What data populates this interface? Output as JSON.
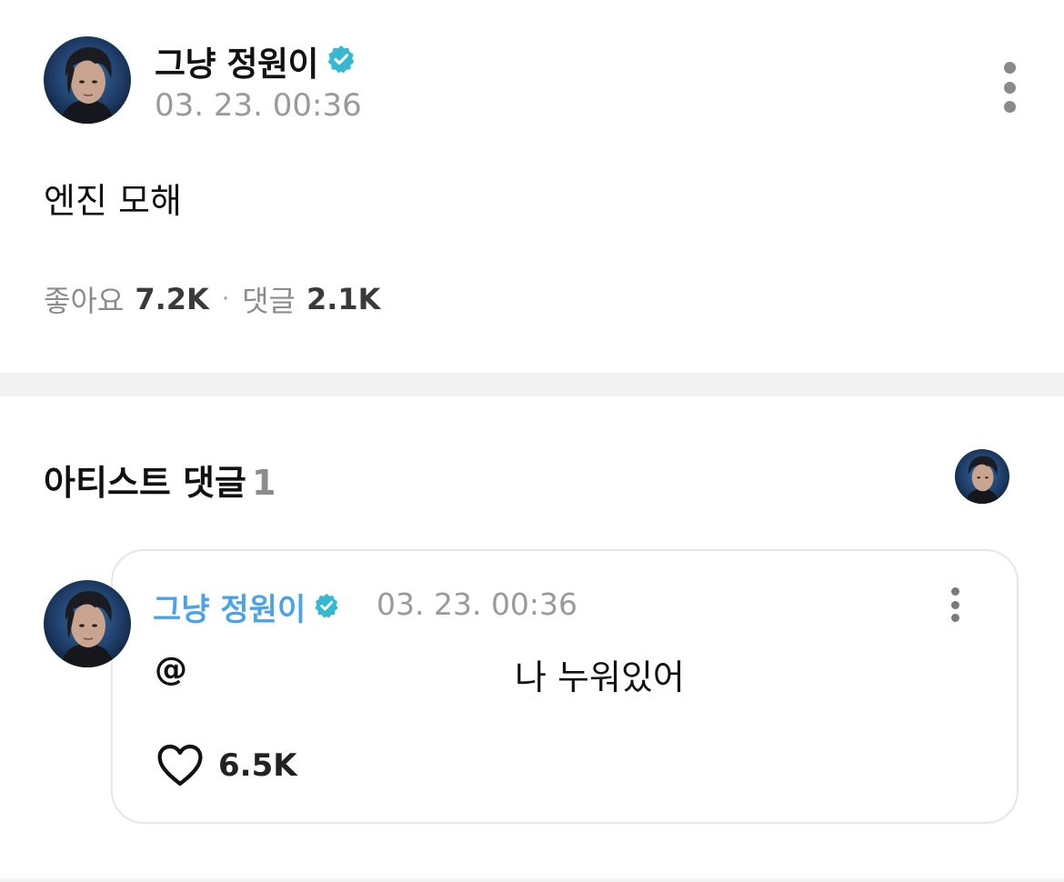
{
  "post": {
    "author": "그냥 정원이",
    "timestamp": "03. 23. 00:36",
    "body": "엔진 모해",
    "likes_label": "좋아요",
    "likes_count": "7.2K",
    "comments_label": "댓글",
    "comments_count": "2.1K",
    "separator": "·"
  },
  "artist_comments": {
    "title": "아티스트 댓글",
    "count": "1"
  },
  "comment": {
    "author": "그냥 정원이",
    "timestamp": "03. 23. 00:36",
    "mention": "@",
    "text": "나 누워있어",
    "likes": "6.5K"
  },
  "colors": {
    "verified_badge": "#35b8d2",
    "comment_author": "#4aa3e8",
    "divider": "#f2f2f2"
  },
  "icons": {
    "verified": "verified-badge-icon",
    "more": "more-vertical-icon",
    "like": "heart-outline-icon"
  }
}
